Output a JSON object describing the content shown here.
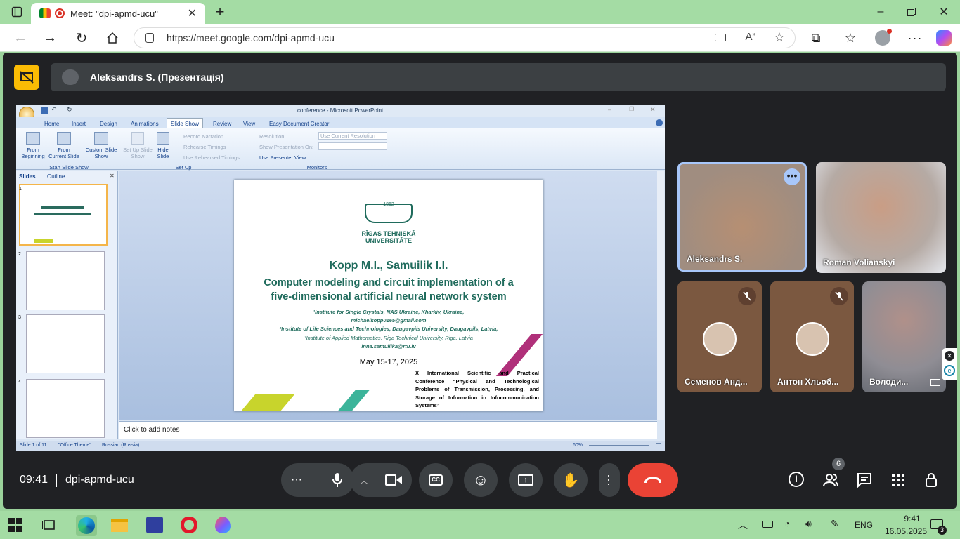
{
  "browser": {
    "tab_title": "Meet: \"dpi-apmd-ucu\"",
    "url": "https://meet.google.com/dpi-apmd-ucu",
    "icons": [
      "tab-actions-icon",
      "meet-favicon",
      "recording-icon",
      "close-icon",
      "new-tab-icon",
      "back-icon",
      "forward-icon",
      "refresh-icon",
      "home-icon",
      "site-info-icon",
      "camera-icon",
      "read-aloud-icon",
      "favorite-icon",
      "extensions-icon",
      "favorites-icon",
      "profile-icon",
      "more-icon",
      "copilot-icon",
      "minimize-icon",
      "restore-icon",
      "window-close-icon"
    ]
  },
  "meet": {
    "presenter_label": "Aleksandrs S. (Презентація)",
    "time": "09:41",
    "meeting_code": "dpi-apmd-ucu",
    "participant_count": "6",
    "participants": [
      {
        "name": "Aleksandrs S."
      },
      {
        "name": "Roman Volianskyi"
      },
      {
        "name": "Семенов Анд..."
      },
      {
        "name": "Антон Хльоб..."
      },
      {
        "name": "Володи..."
      }
    ],
    "controls": [
      "more-options-icon",
      "mic-icon",
      "chevron-up-icon",
      "camera-icon",
      "captions-icon",
      "emoji-icon",
      "present-icon",
      "raise-hand-icon",
      "more-vert-icon",
      "hang-up-icon",
      "info-icon",
      "people-icon",
      "chat-icon",
      "activities-icon",
      "host-controls-icon"
    ],
    "colors": {
      "hangup": "#ea4335",
      "presenting_badge": "#fbbc04",
      "bg": "#202124"
    }
  },
  "ppt": {
    "title": "conference - Microsoft PowerPoint",
    "tabs": [
      "Home",
      "Insert",
      "Design",
      "Animations",
      "Slide Show",
      "Review",
      "View",
      "Easy Document Creator"
    ],
    "active_tab": "Slide Show",
    "ribbon": {
      "from_beginning": "From Beginning",
      "from_current": "From Current Slide",
      "custom_show": "Custom Slide Show",
      "group_start": "Start Slide Show",
      "set_up_show": "Set Up Slide Show",
      "hide_slide": "Hide Slide",
      "record": "Record Narration",
      "rehearse": "Rehearse Timings",
      "use_rehearsed": "Use Rehearsed Timings",
      "group_setup": "Set Up",
      "resolution_label": "Resolution:",
      "resolution_value": "Use Current Resolution",
      "show_on": "Show Presentation On:",
      "presenter_view": "Use Presenter View",
      "group_monitors": "Monitors"
    },
    "pane_tabs": [
      "Slides",
      "Outline"
    ],
    "notes_placeholder": "Click to add notes",
    "status": {
      "slide": "Slide 1 of 11",
      "theme": "\"Office Theme\"",
      "language": "Russian (Russia)",
      "zoom": "60%"
    },
    "slide": {
      "year": "1862",
      "univ1": "RĪGAS TEHNISKĀ",
      "univ2": "UNIVERSITĀTE",
      "authors": "Kopp M.I., Samuilik I.I.",
      "title1": "Computer modeling and circuit implementation of a",
      "title2": "five-dimensional artificial neural network system",
      "aff1": "¹Institute for Single Crystals, NAS Ukraine, Kharkiv, Ukraine,",
      "email1": "michaelkopp0165@gmail.com",
      "aff2": "²Institute of Life Sciences and Technologies, Daugavpils University, Daugavpils, Latvia,",
      "aff3": "³Institute of Applied Mathematics, Riga Technical University, Riga, Latvia",
      "email2": "inna.samuilika@rtu.lv",
      "date": "May 15-17, 2025",
      "conference": "X International Scientific and Practical Conference “Physical and Technological Problems of Transmission, Processing, and Storage of Information in Infocommunication Systems”"
    },
    "thumbs": [
      "1",
      "2",
      "3",
      "4"
    ]
  },
  "taskbar": {
    "language": "ENG",
    "time": "9:41",
    "date": "16.05.2025",
    "notifications": "3"
  }
}
